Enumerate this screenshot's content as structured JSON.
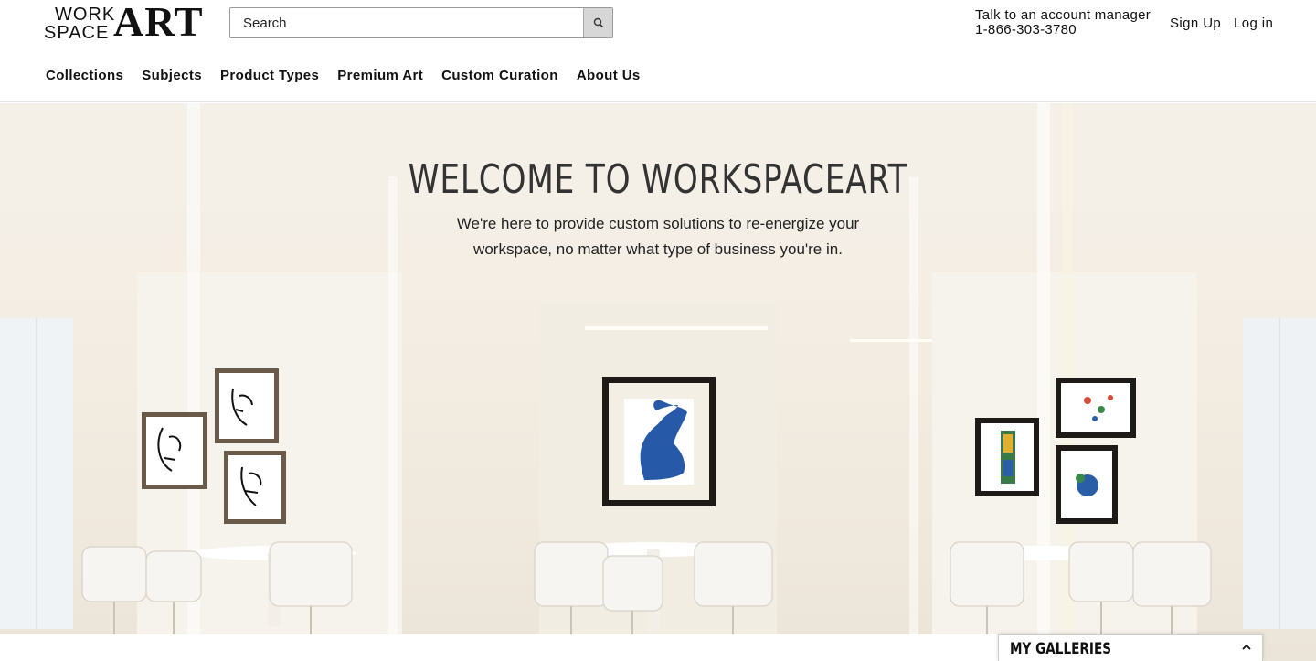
{
  "logo": {
    "line1": "WORK",
    "line2": "SPACE",
    "big": "ART"
  },
  "search": {
    "placeholder": "Search",
    "icon": "search-icon"
  },
  "account": {
    "line1": "Talk to an account manager",
    "phone": "1-866-303-3780"
  },
  "auth": {
    "signup": "Sign Up",
    "login": "Log in"
  },
  "nav": [
    "Collections",
    "Subjects",
    "Product Types",
    "Premium Art",
    "Custom Curation",
    "About Us"
  ],
  "hero": {
    "title": "WELCOME TO WORKSPACEART",
    "subtitle_line1": "We're here to provide custom solutions to re-energize your",
    "subtitle_line2": "workspace, no matter what type of business you're in."
  },
  "galleries": {
    "label": "MY GALLERIES",
    "icon": "chevron-up-icon"
  }
}
